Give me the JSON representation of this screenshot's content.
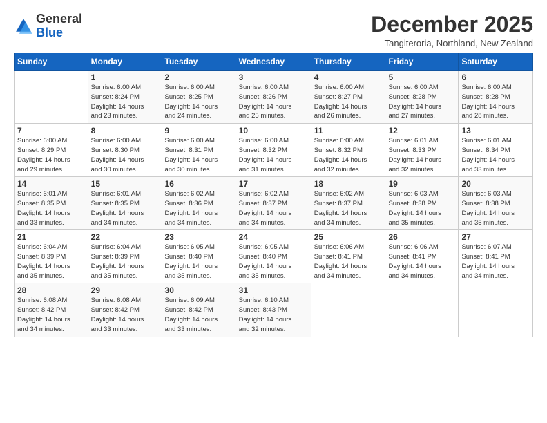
{
  "logo": {
    "general": "General",
    "blue": "Blue"
  },
  "title": "December 2025",
  "subtitle": "Tangiteroria, Northland, New Zealand",
  "weekdays": [
    "Sunday",
    "Monday",
    "Tuesday",
    "Wednesday",
    "Thursday",
    "Friday",
    "Saturday"
  ],
  "weeks": [
    [
      {
        "day": "",
        "info": ""
      },
      {
        "day": "1",
        "info": "Sunrise: 6:00 AM\nSunset: 8:24 PM\nDaylight: 14 hours\nand 23 minutes."
      },
      {
        "day": "2",
        "info": "Sunrise: 6:00 AM\nSunset: 8:25 PM\nDaylight: 14 hours\nand 24 minutes."
      },
      {
        "day": "3",
        "info": "Sunrise: 6:00 AM\nSunset: 8:26 PM\nDaylight: 14 hours\nand 25 minutes."
      },
      {
        "day": "4",
        "info": "Sunrise: 6:00 AM\nSunset: 8:27 PM\nDaylight: 14 hours\nand 26 minutes."
      },
      {
        "day": "5",
        "info": "Sunrise: 6:00 AM\nSunset: 8:28 PM\nDaylight: 14 hours\nand 27 minutes."
      },
      {
        "day": "6",
        "info": "Sunrise: 6:00 AM\nSunset: 8:28 PM\nDaylight: 14 hours\nand 28 minutes."
      }
    ],
    [
      {
        "day": "7",
        "info": "Sunrise: 6:00 AM\nSunset: 8:29 PM\nDaylight: 14 hours\nand 29 minutes."
      },
      {
        "day": "8",
        "info": "Sunrise: 6:00 AM\nSunset: 8:30 PM\nDaylight: 14 hours\nand 30 minutes."
      },
      {
        "day": "9",
        "info": "Sunrise: 6:00 AM\nSunset: 8:31 PM\nDaylight: 14 hours\nand 30 minutes."
      },
      {
        "day": "10",
        "info": "Sunrise: 6:00 AM\nSunset: 8:32 PM\nDaylight: 14 hours\nand 31 minutes."
      },
      {
        "day": "11",
        "info": "Sunrise: 6:00 AM\nSunset: 8:32 PM\nDaylight: 14 hours\nand 32 minutes."
      },
      {
        "day": "12",
        "info": "Sunrise: 6:01 AM\nSunset: 8:33 PM\nDaylight: 14 hours\nand 32 minutes."
      },
      {
        "day": "13",
        "info": "Sunrise: 6:01 AM\nSunset: 8:34 PM\nDaylight: 14 hours\nand 33 minutes."
      }
    ],
    [
      {
        "day": "14",
        "info": "Sunrise: 6:01 AM\nSunset: 8:35 PM\nDaylight: 14 hours\nand 33 minutes."
      },
      {
        "day": "15",
        "info": "Sunrise: 6:01 AM\nSunset: 8:35 PM\nDaylight: 14 hours\nand 34 minutes."
      },
      {
        "day": "16",
        "info": "Sunrise: 6:02 AM\nSunset: 8:36 PM\nDaylight: 14 hours\nand 34 minutes."
      },
      {
        "day": "17",
        "info": "Sunrise: 6:02 AM\nSunset: 8:37 PM\nDaylight: 14 hours\nand 34 minutes."
      },
      {
        "day": "18",
        "info": "Sunrise: 6:02 AM\nSunset: 8:37 PM\nDaylight: 14 hours\nand 34 minutes."
      },
      {
        "day": "19",
        "info": "Sunrise: 6:03 AM\nSunset: 8:38 PM\nDaylight: 14 hours\nand 35 minutes."
      },
      {
        "day": "20",
        "info": "Sunrise: 6:03 AM\nSunset: 8:38 PM\nDaylight: 14 hours\nand 35 minutes."
      }
    ],
    [
      {
        "day": "21",
        "info": "Sunrise: 6:04 AM\nSunset: 8:39 PM\nDaylight: 14 hours\nand 35 minutes."
      },
      {
        "day": "22",
        "info": "Sunrise: 6:04 AM\nSunset: 8:39 PM\nDaylight: 14 hours\nand 35 minutes."
      },
      {
        "day": "23",
        "info": "Sunrise: 6:05 AM\nSunset: 8:40 PM\nDaylight: 14 hours\nand 35 minutes."
      },
      {
        "day": "24",
        "info": "Sunrise: 6:05 AM\nSunset: 8:40 PM\nDaylight: 14 hours\nand 35 minutes."
      },
      {
        "day": "25",
        "info": "Sunrise: 6:06 AM\nSunset: 8:41 PM\nDaylight: 14 hours\nand 34 minutes."
      },
      {
        "day": "26",
        "info": "Sunrise: 6:06 AM\nSunset: 8:41 PM\nDaylight: 14 hours\nand 34 minutes."
      },
      {
        "day": "27",
        "info": "Sunrise: 6:07 AM\nSunset: 8:41 PM\nDaylight: 14 hours\nand 34 minutes."
      }
    ],
    [
      {
        "day": "28",
        "info": "Sunrise: 6:08 AM\nSunset: 8:42 PM\nDaylight: 14 hours\nand 34 minutes."
      },
      {
        "day": "29",
        "info": "Sunrise: 6:08 AM\nSunset: 8:42 PM\nDaylight: 14 hours\nand 33 minutes."
      },
      {
        "day": "30",
        "info": "Sunrise: 6:09 AM\nSunset: 8:42 PM\nDaylight: 14 hours\nand 33 minutes."
      },
      {
        "day": "31",
        "info": "Sunrise: 6:10 AM\nSunset: 8:43 PM\nDaylight: 14 hours\nand 32 minutes."
      },
      {
        "day": "",
        "info": ""
      },
      {
        "day": "",
        "info": ""
      },
      {
        "day": "",
        "info": ""
      }
    ]
  ]
}
